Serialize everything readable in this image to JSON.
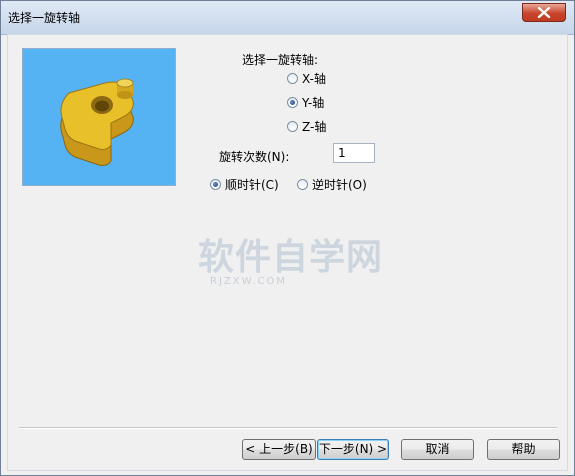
{
  "window": {
    "title": "选择一旋转轴"
  },
  "axis": {
    "heading": "选择一旋转轴:",
    "options": [
      {
        "label": "X-轴",
        "selected": false
      },
      {
        "label": "Y-轴",
        "selected": true
      },
      {
        "label": "Z-轴",
        "selected": false
      }
    ]
  },
  "rotation": {
    "count_label": "旋转次数(N):",
    "count_value": "1"
  },
  "direction": {
    "options": [
      {
        "label": "顺时针(C)",
        "selected": true
      },
      {
        "label": "逆时针(O)",
        "selected": false
      }
    ]
  },
  "watermark": {
    "main": "软件自学网",
    "sub": "RJZXW.COM"
  },
  "buttons": {
    "back": "< 上一步(B)",
    "next": "下一步(N) >",
    "cancel": "取消",
    "help": "帮助"
  },
  "colors": {
    "preview_bg": "#56b3f3",
    "part": "#e8c02a"
  },
  "icons": {
    "close": "close-icon",
    "preview": "cam-part-image"
  }
}
